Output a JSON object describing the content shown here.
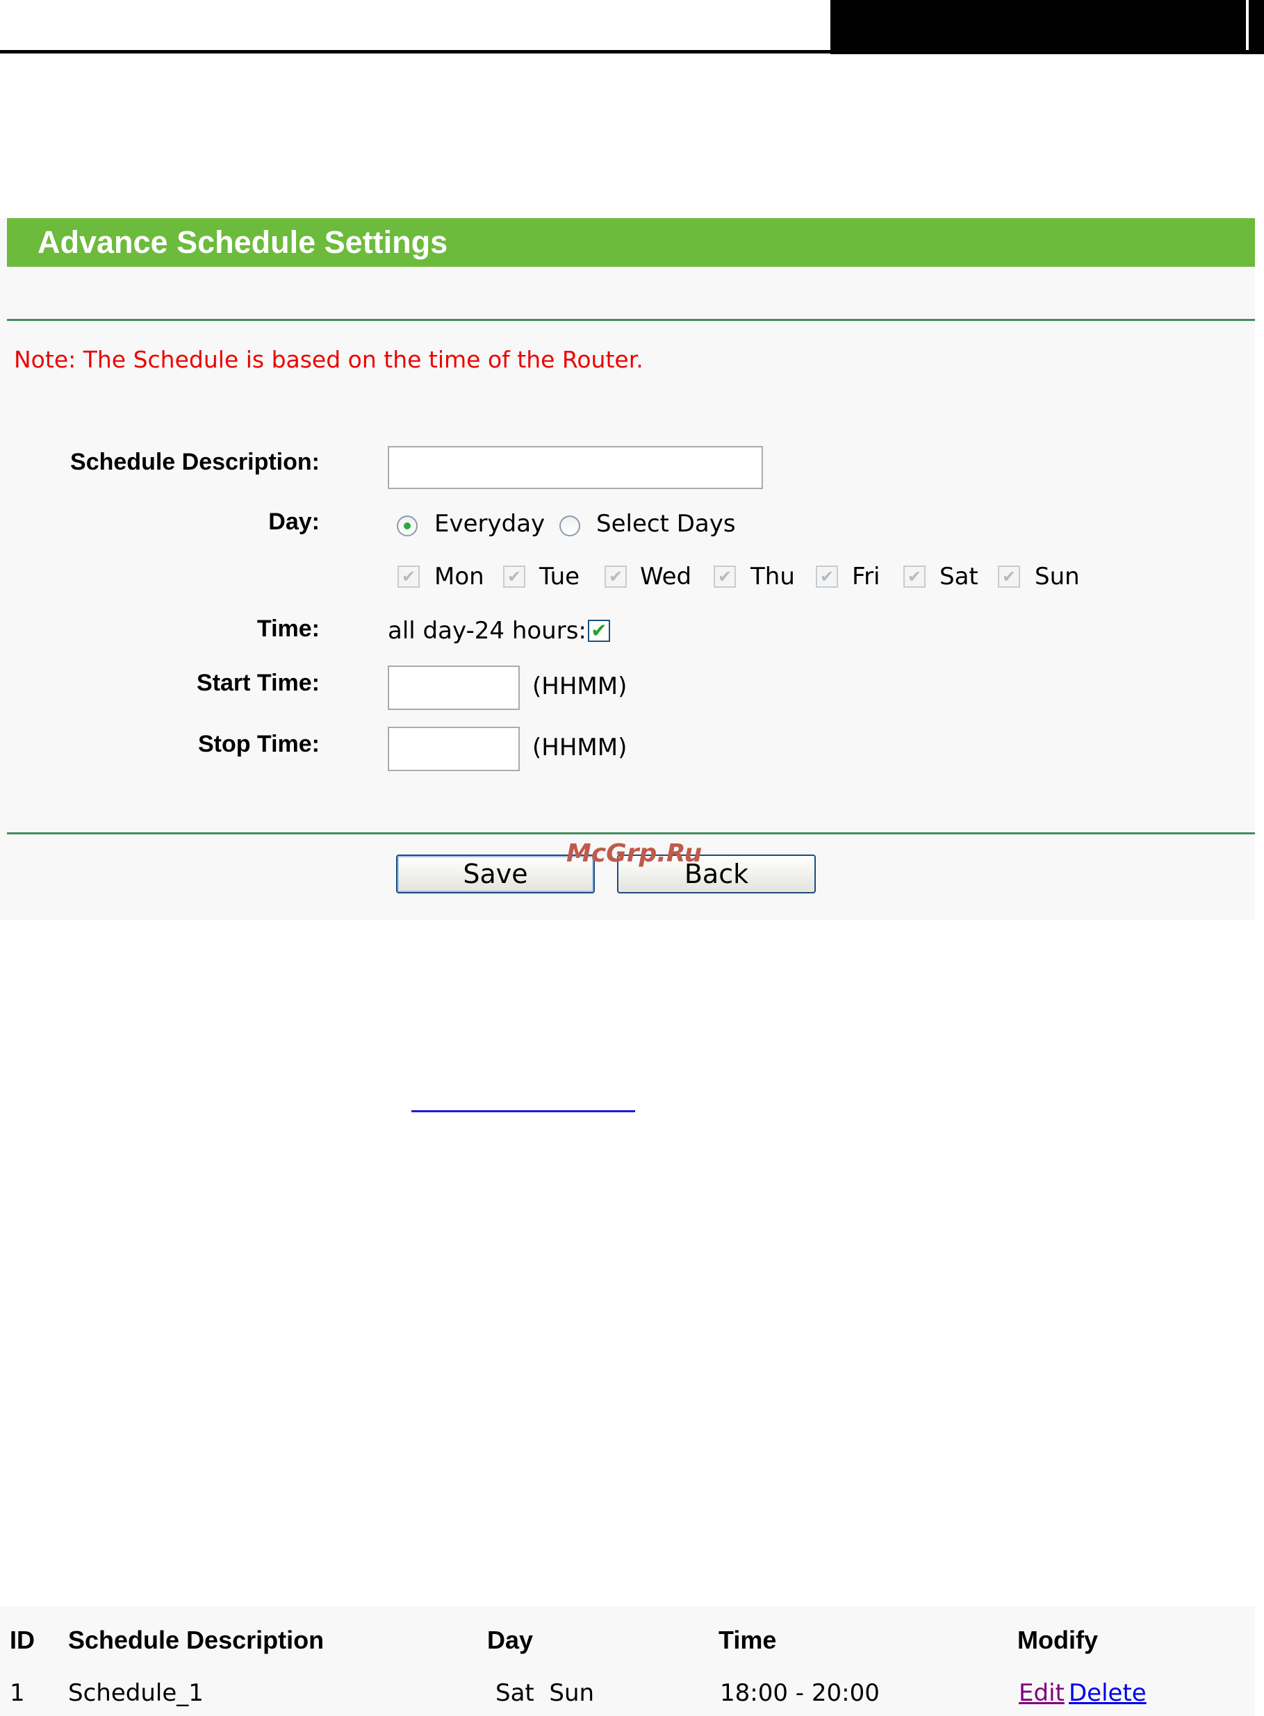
{
  "header": {
    "title": "Advance Schedule Settings"
  },
  "note": "Note: The Schedule is based on the time of the Router.",
  "form": {
    "description_label": "Schedule Description:",
    "description_value": "",
    "day_label": "Day:",
    "day_options": [
      {
        "label": "Everyday",
        "selected": true
      },
      {
        "label": "Select Days",
        "selected": false
      }
    ],
    "days": [
      {
        "label": "Mon",
        "checked": true,
        "disabled": true
      },
      {
        "label": "Tue",
        "checked": true,
        "disabled": true
      },
      {
        "label": "Wed",
        "checked": true,
        "disabled": true
      },
      {
        "label": "Thu",
        "checked": true,
        "disabled": true
      },
      {
        "label": "Fri",
        "checked": true,
        "disabled": true
      },
      {
        "label": "Sat",
        "checked": true,
        "disabled": true
      },
      {
        "label": "Sun",
        "checked": true,
        "disabled": true
      }
    ],
    "time_label": "Time:",
    "allday_label": "all day-24 hours:",
    "allday_checked": true,
    "start_label": "Start Time:",
    "start_value": "",
    "stop_label": "Stop Time:",
    "stop_value": "",
    "format_hint": "(HHMM)"
  },
  "buttons": {
    "save": "Save",
    "back": "Back"
  },
  "watermark": "McGrp.Ru",
  "table": {
    "headers": [
      "ID",
      "Schedule Description",
      "Day",
      "Time",
      "Modify"
    ],
    "rows": [
      {
        "id": "1",
        "description": "Schedule_1",
        "day": "Sat  Sun",
        "time": "18:00 - 20:00",
        "edit": "Edit",
        "delete": "Delete"
      }
    ]
  },
  "colors": {
    "header_bg": "#6cbb3c",
    "note_text": "#ee0000",
    "edit_link": "#800080",
    "delete_link": "#0000ee"
  }
}
